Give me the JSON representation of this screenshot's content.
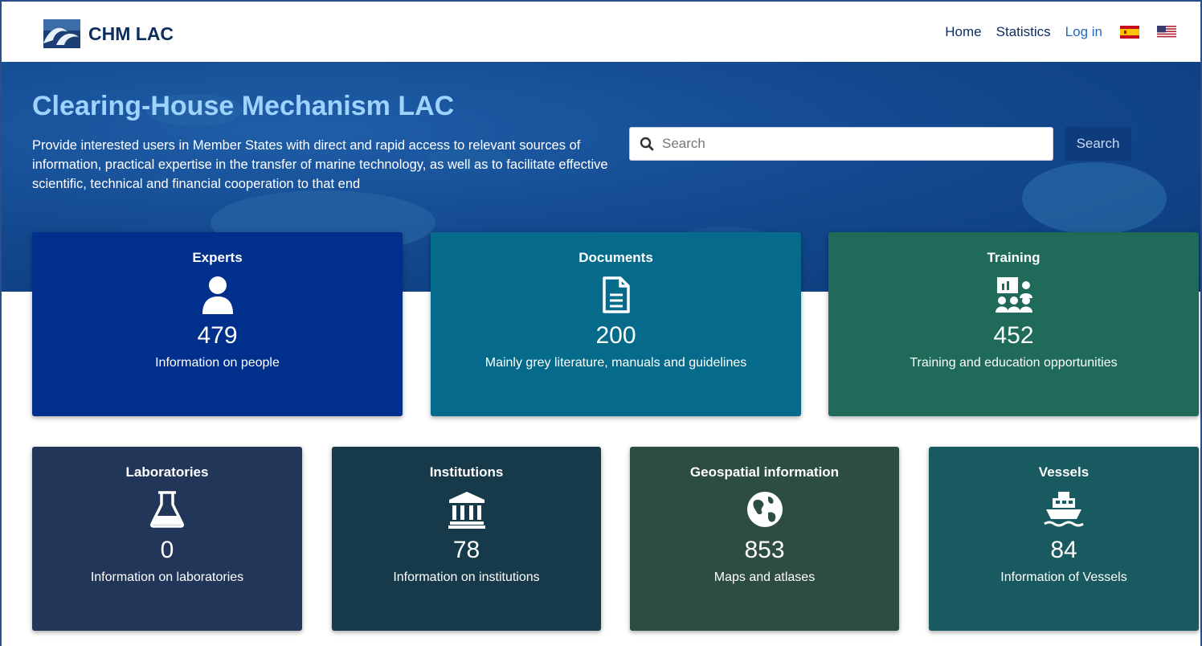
{
  "app": {
    "brand": "CHM LAC"
  },
  "nav": {
    "home": "Home",
    "statistics": "Statistics",
    "login": "Log in"
  },
  "hero": {
    "title": "Clearing-House Mechanism LAC",
    "description": "Provide interested users in Member States with direct and rapid access to relevant sources of information, practical expertise in the transfer of marine technology, as well as to facilitate effective scientific, technical and financial cooperation to that end"
  },
  "search": {
    "placeholder": "Search",
    "button": "Search"
  },
  "cards_top": [
    {
      "title": "Experts",
      "count": "479",
      "desc": "Information on people",
      "color": "#012f8c",
      "icon": "user-icon"
    },
    {
      "title": "Documents",
      "count": "200",
      "desc": "Mainly grey literature, manuals and guidelines",
      "color": "#066b8a",
      "icon": "document-icon"
    },
    {
      "title": "Training",
      "count": "452",
      "desc": "Training and education opportunities",
      "color": "#1f6a59",
      "icon": "training-icon"
    }
  ],
  "cards_bottom": [
    {
      "title": "Laboratories",
      "count": "0",
      "desc": "Information on laboratories",
      "color": "#223659",
      "icon": "flask-icon"
    },
    {
      "title": "Institutions",
      "count": "78",
      "desc": "Information on institutions",
      "color": "#163a49",
      "icon": "institution-icon"
    },
    {
      "title": "Geospatial information",
      "count": "853",
      "desc": "Maps and atlases",
      "color": "#2e4d41",
      "icon": "globe-icon"
    },
    {
      "title": "Vessels",
      "count": "84",
      "desc": "Information of Vessels",
      "color": "#185a5f",
      "icon": "ship-icon"
    }
  ]
}
